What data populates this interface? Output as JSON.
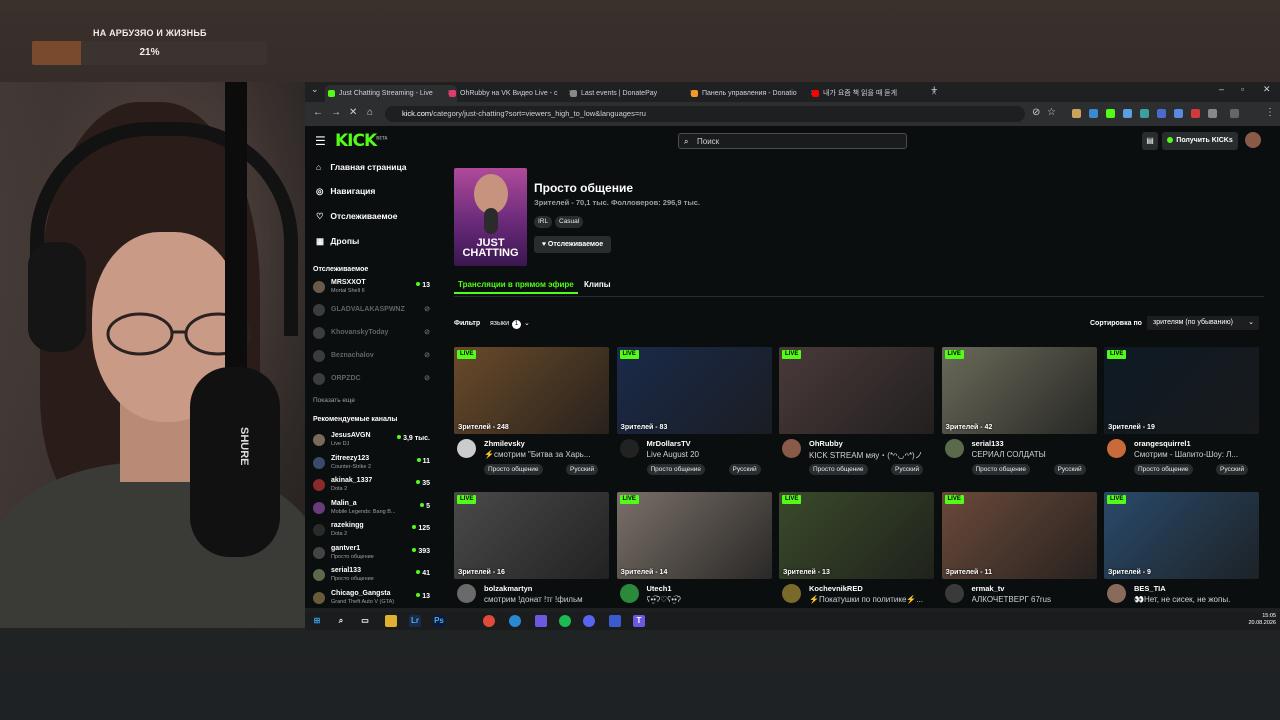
{
  "overlay": {
    "goal_title": "НА АРБУЗЯО И ЖИЗНЬБ",
    "goal_percent_label": "21%",
    "goal_progress": 0.21
  },
  "webcam": {
    "mic_brand": "SHURE"
  },
  "browser": {
    "tabs": [
      {
        "title": "Just Chatting Streaming - Live",
        "color": "#53fc18"
      },
      {
        "title": "OhRubby на VK Видео Live - с",
        "color": "#e33a6d"
      },
      {
        "title": "Last events | DonatePay",
        "color": "#888888"
      },
      {
        "title": "Панель управления - Donatio",
        "color": "#f59b23"
      },
      {
        "title": "내가 요즘 책 읽을 때 듣게",
        "color": "#ff0000"
      }
    ],
    "url_host": "kick.com",
    "url_path": "/category/just-chatting?sort=viewers_high_to_low&languages=ru"
  },
  "kick": {
    "logo": "KICK",
    "logo_badge": "BETA",
    "search_placeholder": "Поиск",
    "get_kicks": "Получить KICKs",
    "sidebar": {
      "nav": [
        {
          "icon": "⌂",
          "label": "Главная страница"
        },
        {
          "icon": "◎",
          "label": "Навигация"
        },
        {
          "icon": "♡",
          "label": "Отслеживаемое"
        },
        {
          "icon": "▦",
          "label": "Дропы"
        }
      ],
      "followed_header": "Отслеживаемое",
      "followed": [
        {
          "name": "MRSXXOT",
          "sub": "Mortal Shell II",
          "count": "13",
          "online": true,
          "color": "#6b5a4a"
        },
        {
          "name": "GLADVALAKASPWNZ",
          "sub": "",
          "count": "",
          "online": false,
          "color": ""
        },
        {
          "name": "KhovanskyToday",
          "sub": "",
          "count": "",
          "online": false,
          "color": ""
        },
        {
          "name": "Beznachalov",
          "sub": "",
          "count": "",
          "online": false,
          "color": ""
        },
        {
          "name": "ORPZDC",
          "sub": "",
          "count": "",
          "online": false,
          "color": ""
        }
      ],
      "show_more": "Показать еще",
      "recommended_header": "Рекомендуемые каналы",
      "recommended": [
        {
          "name": "JesusAVGN",
          "sub": "Live DJ",
          "count": "3,9 тыс.",
          "color": "#7a6a5a"
        },
        {
          "name": "Zitreezy123",
          "sub": "Counter-Strike 2",
          "count": "11",
          "color": "#3a4a6a"
        },
        {
          "name": "akinak_1337",
          "sub": "Dota 2",
          "count": "35",
          "color": "#8a2a2a"
        },
        {
          "name": "Malin_a",
          "sub": "Mobile Legends: Bang B...",
          "count": "5",
          "color": "#6a3a7a"
        },
        {
          "name": "razekingg",
          "sub": "Dota 2",
          "count": "125",
          "color": "#2a2a2a"
        },
        {
          "name": "gantver1",
          "sub": "Просто общение",
          "count": "393",
          "color": "#444444"
        },
        {
          "name": "serial133",
          "sub": "Просто общение",
          "count": "41",
          "color": "#5a6a4a"
        },
        {
          "name": "Chicago_Gangsta",
          "sub": "Grand Theft Auto V (GTA)",
          "count": "13",
          "color": "#6a5a3a"
        }
      ]
    },
    "category": {
      "title": "Просто общение",
      "stats": "Зрителей - 70,1 тыс.   Фолловеров: 296,9 тыс.",
      "tags": [
        "IRL",
        "Casual"
      ],
      "follow_label": "♥ Отслеживаемое",
      "cover_text": "JUST CHATTING"
    },
    "tabs": [
      "Трансляции в прямом эфире",
      "Клипы"
    ],
    "filter_label": "Фильтр",
    "filter_lang": "языки",
    "filter_count": "1",
    "sort_label": "Сортировка по",
    "sort_value": "зрителям (по убыванию)",
    "live_badge": "LIVE",
    "streams": [
      {
        "viewers": "Зрителей - 248",
        "name": "Zhmilevsky",
        "title": "⚡смотрим \"Битва за Харь...",
        "tags": [
          "Просто общение",
          "Русский"
        ],
        "thumb": "#6a4a2a",
        "avatar": "#cccccc"
      },
      {
        "viewers": "Зрителей - 83",
        "name": "MrDollarsTV",
        "title": "Live August 20",
        "tags": [
          "Просто общение",
          "Русский"
        ],
        "thumb": "#1a2a4a",
        "avatar": "#222222"
      },
      {
        "viewers": "",
        "name": "OhRubby",
        "title": "KICK STREAM мяу・(*ᴖ◡ᴖ*)ノ",
        "tags": [
          "Просто общение",
          "Русский"
        ],
        "thumb": "#4a3a3a",
        "avatar": "#8a5a48"
      },
      {
        "viewers": "Зрителей - 42",
        "name": "serial133",
        "title": "СЕРИАЛ СОЛДАТЫ",
        "tags": [
          "Просто общение",
          "Русский"
        ],
        "thumb": "#6a6a5a",
        "avatar": "#5a6a4a"
      },
      {
        "viewers": "Зрителей - 19",
        "name": "orangesquirrel1",
        "title": "Смотрим - Шапито-Шоу: Л...",
        "tags": [
          "Просто общение",
          "Русский"
        ],
        "thumb": "#0e1a24",
        "avatar": "#c86a3a"
      },
      {
        "viewers": "Зрителей - 16",
        "name": "bolzakmartyn",
        "title": "смотрим !донат !тг !фильм",
        "tags": [],
        "thumb": "#4a4a4a",
        "avatar": "#6a6a6a"
      },
      {
        "viewers": "Зрителей - 14",
        "name": "Utech1",
        "title": "ʕ•̫͡•ʔ♡ʕ•̫͡•ʔ",
        "tags": [],
        "thumb": "#7a7068",
        "avatar": "#2a8a3a"
      },
      {
        "viewers": "Зрителей - 13",
        "name": "KochevnikRED",
        "title": "⚡Покатушки по политике⚡...",
        "tags": [],
        "thumb": "#3a4a2a",
        "avatar": "#7a6a2a"
      },
      {
        "viewers": "Зрителей - 11",
        "name": "ermak_tv",
        "title": "АЛКОЧЕТВЕРГ 67rus",
        "tags": [],
        "thumb": "#6a4a3a",
        "avatar": "#3a3a3a"
      },
      {
        "viewers": "Зрителей - 9",
        "name": "BES_TIA",
        "title": "👀Нет, не сисек, не жопы.",
        "tags": [],
        "thumb": "#2a4a6a",
        "avatar": "#8a6a5a"
      }
    ]
  },
  "taskbar": {
    "time": "15:05",
    "date": "20.08.2026"
  }
}
